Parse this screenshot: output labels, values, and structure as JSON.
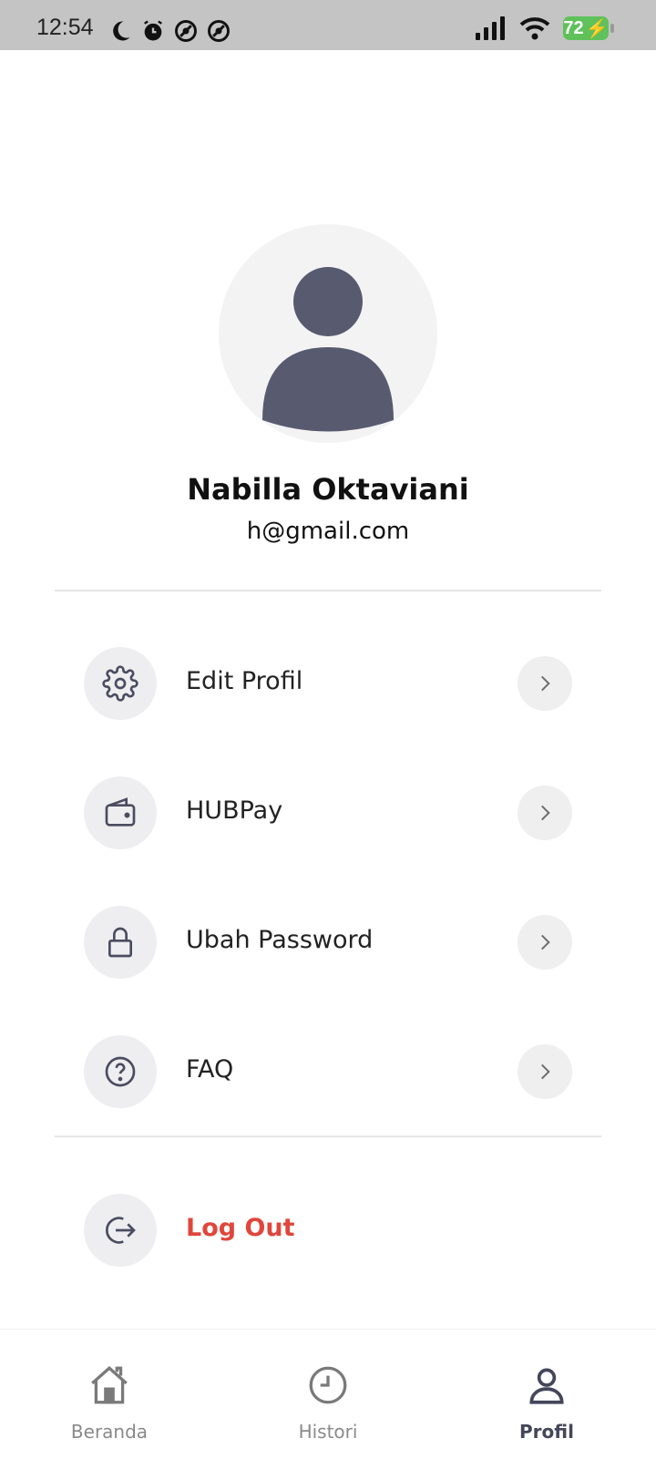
{
  "status_bar": {
    "time": "12:54",
    "battery_level": "72",
    "icons": [
      "moon-icon",
      "alarm-icon",
      "dnd-icon",
      "dnd-icon",
      "signal-icon",
      "wifi-icon",
      "battery-charging-icon"
    ]
  },
  "profile": {
    "name": "Nabilla Oktaviani",
    "email": "h@gmail.com"
  },
  "menu": {
    "items": [
      {
        "label": "Edit Profil",
        "icon": "gear-icon"
      },
      {
        "label": "HUBPay",
        "icon": "wallet-icon"
      },
      {
        "label": "Ubah Password",
        "icon": "lock-icon"
      },
      {
        "label": "FAQ",
        "icon": "question-icon"
      }
    ],
    "logout": {
      "label": "Log Out",
      "icon": "logout-icon",
      "color": "#e0463b"
    }
  },
  "bottom_nav": {
    "items": [
      {
        "label": "Beranda",
        "icon": "home-icon"
      },
      {
        "label": "Histori",
        "icon": "clock-icon"
      },
      {
        "label": "Profil",
        "icon": "user-icon",
        "active": true
      }
    ]
  },
  "colors": {
    "accent_dark": "#44465a",
    "logout_red": "#e0463b",
    "icon_bg": "#eeeef0",
    "battery_green": "#5fc15a"
  }
}
